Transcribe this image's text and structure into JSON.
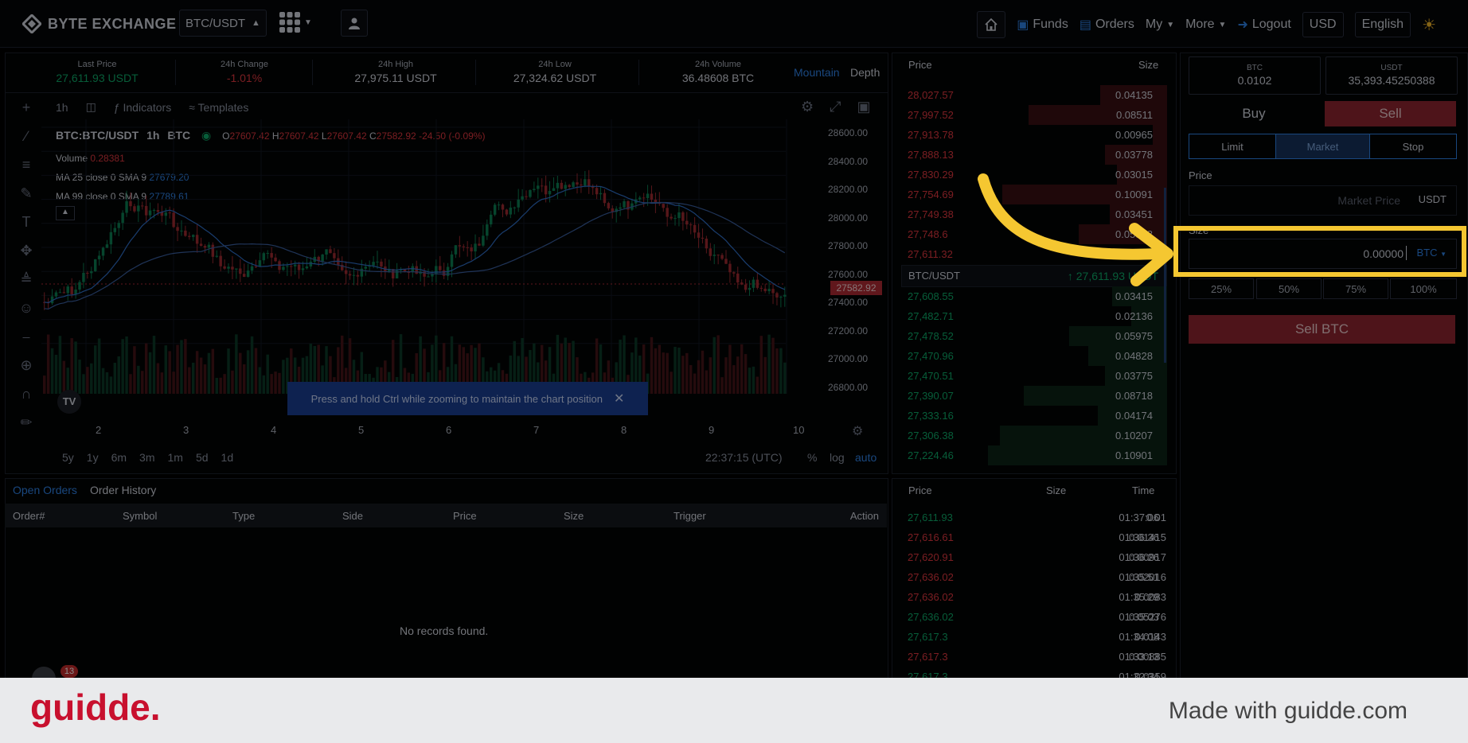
{
  "brand": {
    "name": "BYTE EXCHANGE"
  },
  "nav": {
    "pair": "BTC/USDT",
    "funds": "Funds",
    "orders": "Orders",
    "my": "My",
    "more": "More",
    "logout": "Logout",
    "currency": "USD",
    "language": "English"
  },
  "ticker": {
    "last_price_label": "Last Price",
    "last_price": "27,611.93 USDT",
    "change_label": "24h Change",
    "change": "-1.01%",
    "high_label": "24h High",
    "high": "27,975.11 USDT",
    "low_label": "24h Low",
    "low": "27,324.62 USDT",
    "volume_label": "24h Volume",
    "volume": "36.48608 BTC",
    "mode_mountain": "Mountain",
    "mode_depth": "Depth"
  },
  "chart": {
    "interval": "1h",
    "indicators": "Indicators",
    "templates": "Templates",
    "symbol": "BTC:BTC/USDT",
    "symbol_interval": "1h",
    "symbol_base": "BTC",
    "ohlc": {
      "o": "27607.42",
      "h": "27607.42",
      "l": "27607.42",
      "c": "27582.92",
      "chg": "-24.50 (-0.09%)"
    },
    "volume_label": "Volume",
    "volume_value": "0.28381",
    "ma25_label": "MA 25 close 0 SMA 9",
    "ma25_value": "27679.20",
    "ma99_label": "MA 99 close 0 SMA 9",
    "ma99_value": "27789.61",
    "current_price_tag": "27582.92",
    "y_ticks": [
      "28600.00",
      "28400.00",
      "28200.00",
      "28000.00",
      "27800.00",
      "27600.00",
      "27400.00",
      "27200.00",
      "27000.00",
      "26800.00"
    ],
    "x_ticks": [
      "2",
      "3",
      "4",
      "5",
      "6",
      "7",
      "8",
      "9",
      "10"
    ],
    "ranges": [
      "5y",
      "1y",
      "6m",
      "3m",
      "1m",
      "5d",
      "1d"
    ],
    "clock": "22:37:15 (UTC)",
    "pct": "%",
    "log": "log",
    "auto": "auto",
    "tooltip": "Press and hold Ctrl while zooming to maintain the chart position"
  },
  "orderbook": {
    "price_header": "Price",
    "size_header": "Size",
    "asks": [
      {
        "price": "28,027.57",
        "size": "0.04135",
        "depth": 0.28
      },
      {
        "price": "27,997.52",
        "size": "0.08511",
        "depth": 0.58
      },
      {
        "price": "27,913.78",
        "size": "0.00965",
        "depth": 0.06
      },
      {
        "price": "27,888.13",
        "size": "0.03778",
        "depth": 0.26
      },
      {
        "price": "27,830.29",
        "size": "0.03015",
        "depth": 0.21
      },
      {
        "price": "27,754.69",
        "size": "0.10091",
        "depth": 0.69
      },
      {
        "price": "27,749.38",
        "size": "0.03451",
        "depth": 0.24
      },
      {
        "price": "27,748.6",
        "size": "0.05388",
        "depth": 0.37
      },
      {
        "price": "27,611.32",
        "size": "0.00153",
        "depth": 0.02
      }
    ],
    "mid_pair": "BTC/USDT",
    "mid_price": "27,611.93 USDT",
    "bids": [
      {
        "price": "27,608.55",
        "size": "0.03415",
        "depth": 0.23
      },
      {
        "price": "27,482.71",
        "size": "0.02136",
        "depth": 0.15
      },
      {
        "price": "27,478.52",
        "size": "0.05975",
        "depth": 0.41
      },
      {
        "price": "27,470.96",
        "size": "0.04828",
        "depth": 0.33
      },
      {
        "price": "27,470.51",
        "size": "0.03775",
        "depth": 0.26
      },
      {
        "price": "27,390.07",
        "size": "0.08718",
        "depth": 0.6
      },
      {
        "price": "27,333.16",
        "size": "0.04174",
        "depth": 0.29
      },
      {
        "price": "27,306.38",
        "size": "0.10207",
        "depth": 0.7
      },
      {
        "price": "27,224.46",
        "size": "0.10901",
        "depth": 0.75
      }
    ]
  },
  "trade": {
    "bal_btc_label": "BTC",
    "bal_btc": "0.0102",
    "bal_usdt_label": "USDT",
    "bal_usdt": "35,393.45250388",
    "buy": "Buy",
    "sell": "Sell",
    "limit": "Limit",
    "market": "Market",
    "stop": "Stop",
    "price_label": "Price",
    "price_placeholder": "Market Price",
    "price_unit": "USDT",
    "size_label": "Size",
    "size_value": "0.00000",
    "size_unit": "BTC",
    "pcts": [
      "25%",
      "50%",
      "75%",
      "100%"
    ],
    "submit": "Sell BTC"
  },
  "orders": {
    "tab_open": "Open Orders",
    "tab_history": "Order History",
    "columns": [
      "Order#",
      "Symbol",
      "Type",
      "Side",
      "Price",
      "Size",
      "Trigger",
      "Action"
    ],
    "empty": "No records found.",
    "badge": "13"
  },
  "trades": {
    "price_header": "Price",
    "size_header": "Size",
    "time_header": "Time",
    "rows": [
      {
        "price": "27,611.93",
        "size": "0.01",
        "time": "01:37:06",
        "side": "buy"
      },
      {
        "price": "27,616.61",
        "size": "0.01415",
        "time": "01:36:36",
        "side": "sell"
      },
      {
        "price": "27,620.91",
        "size": "0.00917",
        "time": "01:36:26",
        "side": "sell"
      },
      {
        "price": "27,636.02",
        "size": "0.02016",
        "time": "01:35:51",
        "side": "sell"
      },
      {
        "price": "27,636.02",
        "size": "0.0083",
        "time": "01:35:29",
        "side": "sell"
      },
      {
        "price": "27,636.02",
        "size": "0.05276",
        "time": "01:35:03",
        "side": "buy"
      },
      {
        "price": "27,617.3",
        "size": "0.0143",
        "time": "01:34:08",
        "side": "buy"
      },
      {
        "price": "27,617.3",
        "size": "0.00885",
        "time": "01:33:13",
        "side": "sell"
      },
      {
        "price": "27,617.3",
        "size": "0.0359",
        "time": "01:32:34",
        "side": "buy"
      }
    ]
  },
  "footer": {
    "logo": "guidde.",
    "credit": "Made with guidde.com"
  },
  "colors": {
    "accent": "#2f82e6",
    "sell": "#8e2530",
    "highlight": "#f5c731",
    "up": "#0ea968",
    "down": "#e0373f"
  }
}
